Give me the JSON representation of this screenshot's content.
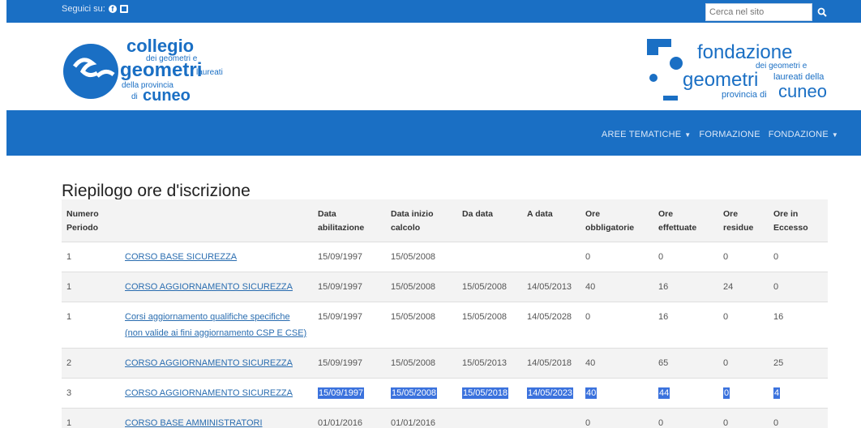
{
  "topbar": {
    "follow_label": "Seguici su:",
    "social_icons": [
      "facebook-icon",
      "twitter-icon"
    ],
    "search_placeholder": "Cerca nel sito",
    "search_icon": "search-icon"
  },
  "logos": {
    "left": {
      "line1": "collegio",
      "line2": "dei geometri e",
      "line3": "geometri",
      "line4": "laureati",
      "line5": "della provincia",
      "line6": "di",
      "line7": "cuneo"
    },
    "right": {
      "line1": "fondazione",
      "line2": "dei geometri e",
      "line3": "geometri",
      "line4": "laureati della",
      "line5": "provincia di",
      "line6": "cuneo"
    }
  },
  "nav": {
    "items": [
      {
        "label": "AREE TEMATICHE",
        "has_caret": true
      },
      {
        "label": "FORMAZIONE",
        "has_caret": false
      },
      {
        "label": "FONDAZIONE",
        "has_caret": true
      }
    ]
  },
  "page": {
    "title": "Riepilogo ore d'iscrizione"
  },
  "table": {
    "headers": [
      "Numero Periodo",
      "",
      "Data abilitazione",
      "Data inizio calcolo",
      "Da data",
      "A data",
      "Ore obbligatorie",
      "Ore effettuate",
      "Ore residue",
      "Ore in Eccesso"
    ],
    "rows": [
      [
        "1",
        "CORSO BASE SICUREZZA",
        "15/09/1997",
        "15/05/2008",
        "",
        "",
        "0",
        "0",
        "0",
        "0"
      ],
      [
        "1",
        "CORSO AGGIORNAMENTO SICUREZZA",
        "15/09/1997",
        "15/05/2008",
        "15/05/2008",
        "14/05/2013",
        "40",
        "16",
        "24",
        "0"
      ],
      [
        "1",
        "Corsi aggiornamento qualifiche specifiche (non valide ai fini aggiornamento CSP E CSE)",
        "15/09/1997",
        "15/05/2008",
        "15/05/2008",
        "14/05/2028",
        "0",
        "16",
        "0",
        "16"
      ],
      [
        "2",
        "CORSO AGGIORNAMENTO SICUREZZA",
        "15/09/1997",
        "15/05/2008",
        "15/05/2013",
        "14/05/2018",
        "40",
        "65",
        "0",
        "25"
      ],
      [
        "3",
        "CORSO AGGIORNAMENTO SICUREZZA",
        "15/09/1997",
        "15/05/2008",
        "15/05/2018",
        "14/05/2023",
        "40",
        "44",
        "0",
        "4"
      ],
      [
        "1",
        "CORSO BASE AMMINISTRATORI",
        "01/01/2016",
        "01/01/2016",
        "",
        "",
        "0",
        "0",
        "0",
        "0"
      ]
    ],
    "selected_row_index": 4
  },
  "colors": {
    "brand_blue": "#1a6fc4",
    "selection_blue": "#3b72dd",
    "link_blue": "#2a6db0"
  }
}
